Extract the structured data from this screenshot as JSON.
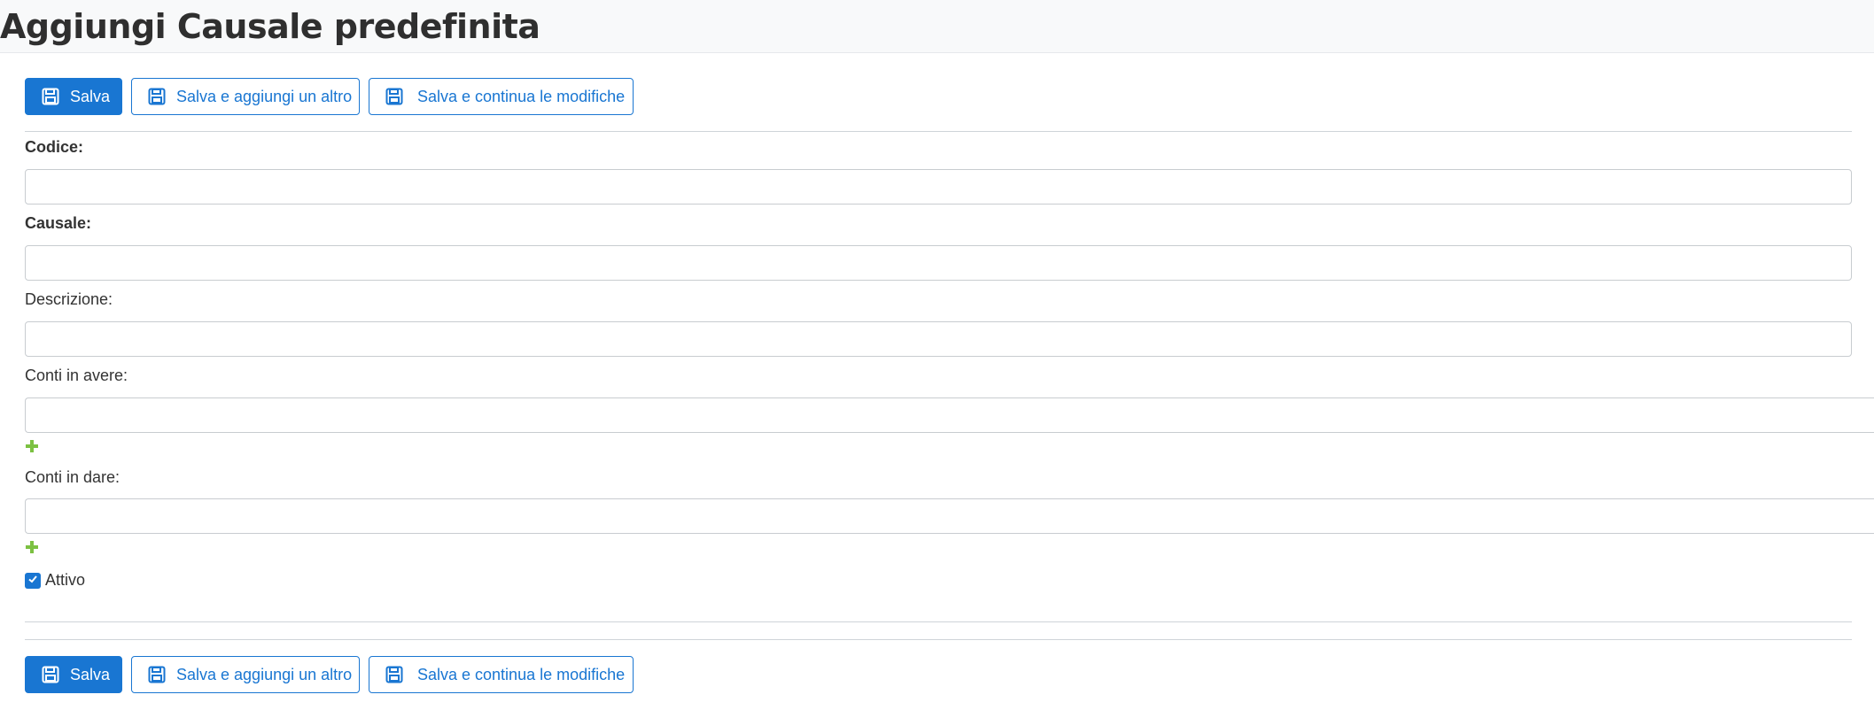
{
  "page": {
    "title": "Aggiungi Causale predefinita"
  },
  "toolbar": {
    "save_label": "Salva",
    "save_add_label": "Salva e aggiungi un altro",
    "save_continue_label": "Salva e continua le modifiche"
  },
  "form": {
    "codice": {
      "label": "Codice:",
      "value": ""
    },
    "causale": {
      "label": "Causale:",
      "value": ""
    },
    "descrizione": {
      "label": "Descrizione:",
      "value": ""
    },
    "conti_avere": {
      "label": "Conti in avere:",
      "value": ""
    },
    "conti_dare": {
      "label": "Conti in dare:",
      "value": ""
    },
    "attivo": {
      "label": "Attivo",
      "checked": true
    }
  },
  "icons": {
    "save": "floppy-disk-icon",
    "add": "plus-icon",
    "check": "check-icon"
  },
  "colors": {
    "primary": "#1976d2",
    "add_green": "#7cc142",
    "header_bg": "#f8f9fa"
  }
}
